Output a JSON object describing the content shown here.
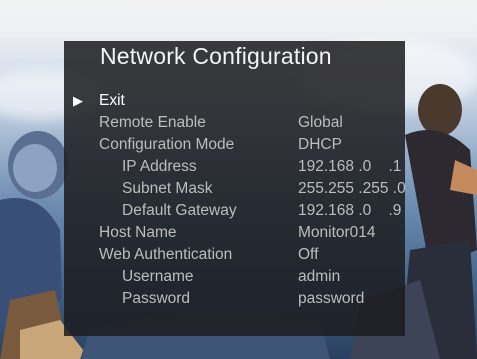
{
  "osd": {
    "title": "Network Configuration",
    "cursor_glyph": "▶",
    "items": [
      {
        "label": "Exit",
        "value": ""
      },
      {
        "label": "Remote Enable",
        "value": "Global"
      },
      {
        "label": "Configuration Mode",
        "value": "DHCP"
      },
      {
        "label": "IP Address",
        "value": "192.168 .0    .1"
      },
      {
        "label": "Subnet Mask",
        "value": "255.255 .255 .0"
      },
      {
        "label": "Default Gateway",
        "value": "192.168 .0    .9"
      },
      {
        "label": "Host Name",
        "value": "Monitor014"
      },
      {
        "label": "Web Authentication",
        "value": "Off"
      },
      {
        "label": "Username",
        "value": "admin"
      },
      {
        "label": "Password",
        "value": "password"
      }
    ]
  },
  "colors": {
    "panel_bg": "#1c1c1e",
    "text_active": "#ffffff",
    "text_normal": "#bdbdbd"
  }
}
